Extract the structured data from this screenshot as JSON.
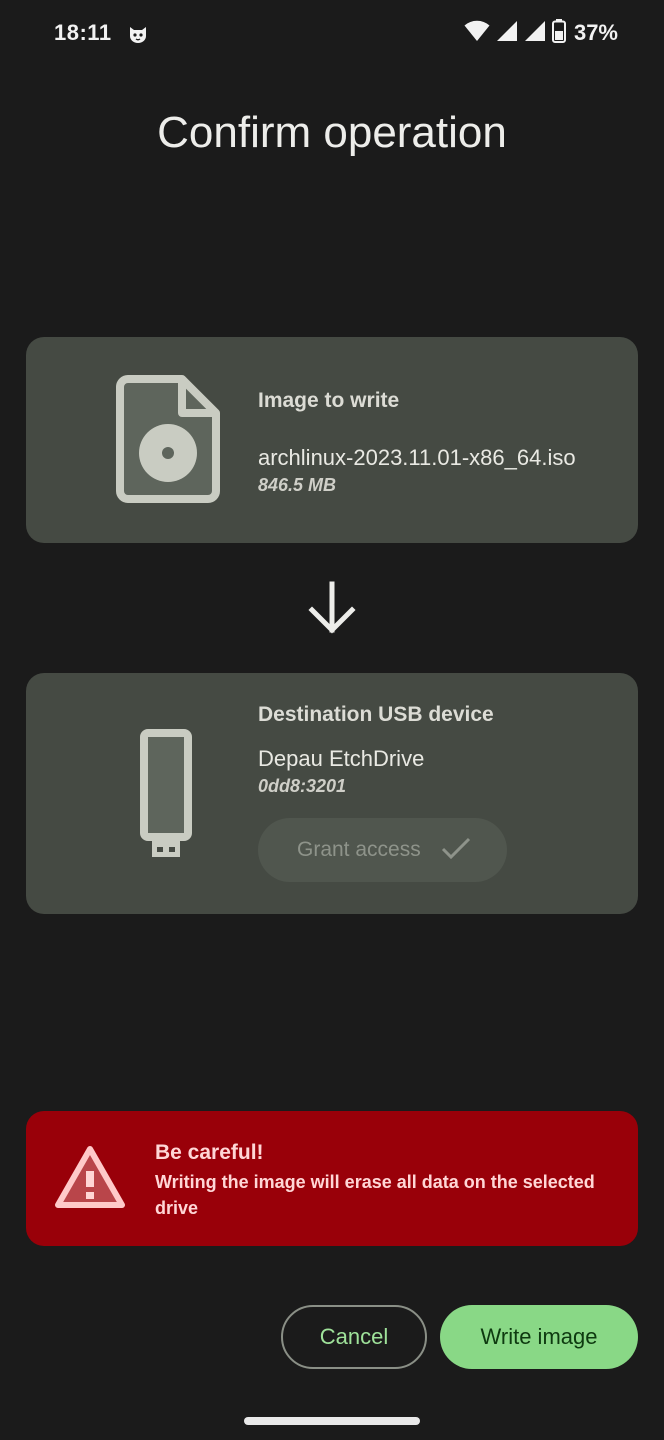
{
  "status_bar": {
    "time": "18:11",
    "app_icon": "cat-face-icon",
    "wifi_icon": "wifi-icon",
    "signal_icons": [
      "signal-icon",
      "signal-icon"
    ],
    "battery_icon": "battery-icon",
    "battery_percent": "37%"
  },
  "page": {
    "title": "Confirm operation"
  },
  "image_card": {
    "icon": "disc-image-file-icon",
    "heading": "Image to write",
    "filename": "archlinux-2023.11.01-x86_64.iso",
    "size": "846.5 MB"
  },
  "arrow_icon": "arrow-down-icon",
  "device_card": {
    "icon": "usb-drive-icon",
    "heading": "Destination USB device",
    "device_name": "Depau EtchDrive",
    "device_id": "0dd8:3201",
    "grant_button": {
      "label": "Grant access",
      "icon": "checkmark-icon",
      "state": "disabled"
    }
  },
  "warning": {
    "icon": "warning-icon",
    "title": "Be careful!",
    "text": "Writing the image will erase all data on the selected drive"
  },
  "actions": {
    "cancel_label": "Cancel",
    "write_label": "Write image"
  },
  "colors": {
    "background": "#1b1b1b",
    "card": "#454a43",
    "warning": "#990009",
    "accent": "#89d886"
  }
}
